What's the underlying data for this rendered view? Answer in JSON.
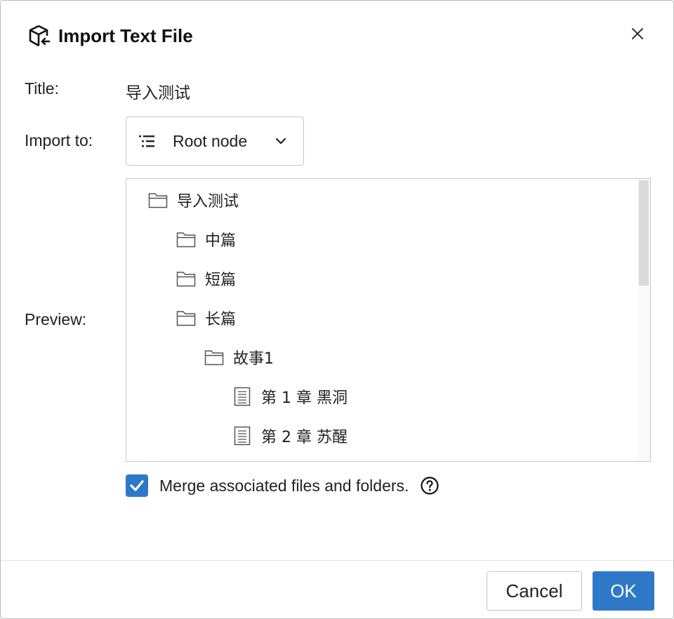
{
  "dialog": {
    "title": "Import Text File",
    "logo_icon": "cube-import-icon",
    "close_icon": "close-icon"
  },
  "form": {
    "title_label": "Title:",
    "title_value": "导入测试",
    "import_to_label": "Import to:",
    "import_to_value": "Root node",
    "import_to_icon": "list-indent-icon",
    "preview_label": "Preview:"
  },
  "preview": {
    "items": [
      {
        "label": "导入测试",
        "type": "folder",
        "level": 0
      },
      {
        "label": "中篇",
        "type": "folder",
        "level": 1
      },
      {
        "label": "短篇",
        "type": "folder",
        "level": 1
      },
      {
        "label": "长篇",
        "type": "folder",
        "level": 1
      },
      {
        "label": "故事1",
        "type": "folder",
        "level": 2
      },
      {
        "label": "第 1 章 黑洞",
        "type": "document",
        "level": 3
      },
      {
        "label": "第 2 章 苏醒",
        "type": "document",
        "level": 3
      }
    ]
  },
  "merge": {
    "label": "Merge associated files and folders.",
    "checked": true,
    "help_icon": "help-circle-icon"
  },
  "footer": {
    "cancel_label": "Cancel",
    "ok_label": "OK"
  },
  "colors": {
    "accent": "#2f78c8",
    "border": "#c8c8c8",
    "scroll_thumb": "#dadada"
  }
}
